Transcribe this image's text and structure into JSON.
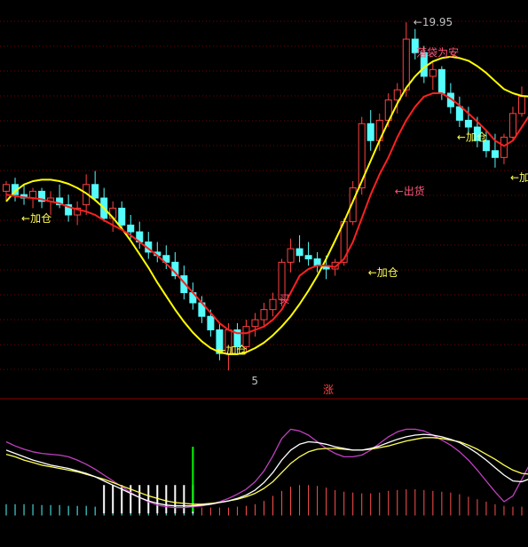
{
  "colors": {
    "up": "#ff4040",
    "down": "#54fcfc",
    "ma_fast": "#ff2020",
    "ma_slow": "#ffff00",
    "annotation": "#ffff54",
    "sell_annotation": "#ff5577",
    "price_label": "#c0c0c0",
    "separator": "#8b0000",
    "grid": "#7a0000",
    "k_line": "#ffffff",
    "d_line": "#ffff54",
    "j_line": "#c040c0",
    "hist_pos": "#ff5050",
    "hist_neg": "#54fcfc",
    "buy_bar": "#ffffff",
    "buy_marker": "#00ff00"
  },
  "chart_data": [
    {
      "type": "candlestick",
      "title": "",
      "grid": true,
      "ylim": [
        14.5,
        20.2
      ],
      "price_labels": {
        "high": "19.95",
        "low_fragment": "5"
      },
      "annotations": [
        {
          "index": 1,
          "text": "←加仓",
          "kind": "buy",
          "price": 17.05
        },
        {
          "index": 0,
          "text": "←加仓",
          "kind": "buy",
          "price": 15.1
        },
        {
          "index": 12,
          "text": "买",
          "kind": "buy",
          "price": 15.85
        },
        {
          "index": 21,
          "text": "←加仓",
          "kind": "buy",
          "price": 16.25
        },
        {
          "index": 17,
          "text": "←出货",
          "kind": "sell",
          "price": 17.45
        },
        {
          "index": 31,
          "text": "-落袋为安",
          "kind": "sell",
          "price": 19.5
        },
        {
          "index": 32,
          "text": "←加仓",
          "kind": "buy",
          "price": 18.25
        },
        {
          "index": 39,
          "text": "←加仓",
          "kind": "buy",
          "price": 17.65
        }
      ],
      "candles": [
        {
          "o": 17.45,
          "h": 17.6,
          "l": 17.3,
          "c": 17.55
        },
        {
          "o": 17.55,
          "h": 17.65,
          "l": 17.3,
          "c": 17.4
        },
        {
          "o": 17.4,
          "h": 17.55,
          "l": 17.25,
          "c": 17.35
        },
        {
          "o": 17.35,
          "h": 17.5,
          "l": 17.2,
          "c": 17.45
        },
        {
          "o": 17.45,
          "h": 17.5,
          "l": 17.2,
          "c": 17.3
        },
        {
          "o": 17.3,
          "h": 17.45,
          "l": 17.1,
          "c": 17.35
        },
        {
          "o": 17.35,
          "h": 17.55,
          "l": 17.2,
          "c": 17.25
        },
        {
          "o": 17.25,
          "h": 17.4,
          "l": 17.0,
          "c": 17.1
        },
        {
          "o": 17.1,
          "h": 17.3,
          "l": 16.95,
          "c": 17.2
        },
        {
          "o": 17.25,
          "h": 17.7,
          "l": 17.1,
          "c": 17.55
        },
        {
          "o": 17.55,
          "h": 17.75,
          "l": 17.3,
          "c": 17.35
        },
        {
          "o": 17.35,
          "h": 17.5,
          "l": 17.0,
          "c": 17.05
        },
        {
          "o": 17.05,
          "h": 17.3,
          "l": 16.85,
          "c": 17.2
        },
        {
          "o": 17.2,
          "h": 17.3,
          "l": 16.9,
          "c": 16.95
        },
        {
          "o": 16.95,
          "h": 17.1,
          "l": 16.75,
          "c": 16.85
        },
        {
          "o": 16.85,
          "h": 17.0,
          "l": 16.6,
          "c": 16.7
        },
        {
          "o": 16.7,
          "h": 16.85,
          "l": 16.45,
          "c": 16.55
        },
        {
          "o": 16.55,
          "h": 16.7,
          "l": 16.4,
          "c": 16.5
        },
        {
          "o": 16.5,
          "h": 16.65,
          "l": 16.3,
          "c": 16.4
        },
        {
          "o": 16.4,
          "h": 16.55,
          "l": 16.15,
          "c": 16.2
        },
        {
          "o": 16.2,
          "h": 16.35,
          "l": 15.85,
          "c": 15.95
        },
        {
          "o": 15.95,
          "h": 16.1,
          "l": 15.7,
          "c": 15.8
        },
        {
          "o": 15.8,
          "h": 15.9,
          "l": 15.5,
          "c": 15.6
        },
        {
          "o": 15.6,
          "h": 15.7,
          "l": 15.3,
          "c": 15.4
        },
        {
          "o": 15.4,
          "h": 15.5,
          "l": 14.95,
          "c": 15.05
        },
        {
          "o": 15.05,
          "h": 15.5,
          "l": 14.8,
          "c": 15.4
        },
        {
          "o": 15.4,
          "h": 15.5,
          "l": 15.05,
          "c": 15.15
        },
        {
          "o": 15.15,
          "h": 15.55,
          "l": 15.05,
          "c": 15.45
        },
        {
          "o": 15.45,
          "h": 15.65,
          "l": 15.3,
          "c": 15.55
        },
        {
          "o": 15.55,
          "h": 15.8,
          "l": 15.45,
          "c": 15.7
        },
        {
          "o": 15.7,
          "h": 15.95,
          "l": 15.6,
          "c": 15.85
        },
        {
          "o": 15.85,
          "h": 16.45,
          "l": 15.75,
          "c": 16.4
        },
        {
          "o": 16.4,
          "h": 16.75,
          "l": 16.25,
          "c": 16.6
        },
        {
          "o": 16.6,
          "h": 16.8,
          "l": 16.4,
          "c": 16.5
        },
        {
          "o": 16.5,
          "h": 16.7,
          "l": 16.35,
          "c": 16.45
        },
        {
          "o": 16.45,
          "h": 16.55,
          "l": 16.25,
          "c": 16.35
        },
        {
          "o": 16.35,
          "h": 16.5,
          "l": 16.15,
          "c": 16.3
        },
        {
          "o": 16.3,
          "h": 16.45,
          "l": 16.2,
          "c": 16.4
        },
        {
          "o": 16.4,
          "h": 17.05,
          "l": 16.35,
          "c": 17.0
        },
        {
          "o": 17.0,
          "h": 17.6,
          "l": 16.95,
          "c": 17.5
        },
        {
          "o": 17.5,
          "h": 18.55,
          "l": 17.4,
          "c": 18.45
        },
        {
          "o": 18.45,
          "h": 18.65,
          "l": 18.05,
          "c": 18.2
        },
        {
          "o": 18.2,
          "h": 18.6,
          "l": 18.05,
          "c": 18.5
        },
        {
          "o": 18.5,
          "h": 18.9,
          "l": 18.4,
          "c": 18.8
        },
        {
          "o": 18.8,
          "h": 19.05,
          "l": 18.6,
          "c": 18.95
        },
        {
          "o": 18.95,
          "h": 19.95,
          "l": 18.85,
          "c": 19.7
        },
        {
          "o": 19.7,
          "h": 19.85,
          "l": 19.4,
          "c": 19.5
        },
        {
          "o": 19.5,
          "h": 19.6,
          "l": 19.05,
          "c": 19.15
        },
        {
          "o": 19.15,
          "h": 19.35,
          "l": 18.95,
          "c": 19.25
        },
        {
          "o": 19.25,
          "h": 19.3,
          "l": 18.8,
          "c": 18.9
        },
        {
          "o": 18.9,
          "h": 19.05,
          "l": 18.6,
          "c": 18.7
        },
        {
          "o": 18.7,
          "h": 18.85,
          "l": 18.4,
          "c": 18.5
        },
        {
          "o": 18.5,
          "h": 18.7,
          "l": 18.3,
          "c": 18.4
        },
        {
          "o": 18.4,
          "h": 18.55,
          "l": 18.1,
          "c": 18.2
        },
        {
          "o": 18.2,
          "h": 18.35,
          "l": 17.95,
          "c": 18.05
        },
        {
          "o": 18.05,
          "h": 18.3,
          "l": 17.8,
          "c": 17.95
        },
        {
          "o": 17.95,
          "h": 18.3,
          "l": 17.85,
          "c": 18.25
        },
        {
          "o": 18.25,
          "h": 18.7,
          "l": 18.2,
          "c": 18.6
        },
        {
          "o": 18.6,
          "h": 19.0,
          "l": 18.55,
          "c": 18.85
        }
      ],
      "ma_fast": [
        17.4,
        17.38,
        17.36,
        17.35,
        17.33,
        17.3,
        17.27,
        17.22,
        17.18,
        17.15,
        17.1,
        17.02,
        16.95,
        16.88,
        16.8,
        16.7,
        16.6,
        16.5,
        16.38,
        16.25,
        16.1,
        15.95,
        15.8,
        15.65,
        15.5,
        15.4,
        15.35,
        15.35,
        15.4,
        15.45,
        15.55,
        15.7,
        15.95,
        16.2,
        16.3,
        16.35,
        16.35,
        16.33,
        16.45,
        16.7,
        17.05,
        17.4,
        17.7,
        17.95,
        18.25,
        18.5,
        18.7,
        18.85,
        18.9,
        18.9,
        18.82,
        18.72,
        18.6,
        18.48,
        18.35,
        18.2,
        18.12,
        18.2,
        18.4,
        18.6
      ],
      "ma_slow": [
        17.3,
        17.45,
        17.55,
        17.6,
        17.62,
        17.62,
        17.6,
        17.56,
        17.5,
        17.42,
        17.32,
        17.2,
        17.06,
        16.9,
        16.72,
        16.52,
        16.32,
        16.1,
        15.9,
        15.7,
        15.52,
        15.36,
        15.23,
        15.13,
        15.07,
        15.04,
        15.04,
        15.07,
        15.13,
        15.21,
        15.32,
        15.45,
        15.6,
        15.78,
        15.98,
        16.2,
        16.45,
        16.72,
        17.0,
        17.3,
        17.6,
        17.9,
        18.2,
        18.48,
        18.75,
        18.98,
        19.15,
        19.28,
        19.37,
        19.42,
        19.44,
        19.42,
        19.38,
        19.3,
        19.2,
        19.08,
        18.96,
        18.9,
        18.86,
        18.85
      ]
    },
    {
      "type": "line",
      "title": "涨",
      "legend": false,
      "grid": false,
      "ylim": [
        -40,
        120
      ],
      "series": [
        {
          "values": [
            80,
            75,
            71,
            68,
            66,
            65,
            64,
            62,
            58,
            53,
            47,
            40,
            33,
            26,
            19,
            13,
            8,
            4,
            2,
            1,
            1,
            2,
            3,
            5,
            8,
            12,
            17,
            23,
            32,
            45,
            63,
            84,
            95,
            93,
            88,
            80,
            72,
            66,
            62,
            62,
            64,
            70,
            78,
            86,
            92,
            95,
            95,
            93,
            88,
            82,
            76,
            68,
            58,
            46,
            33,
            20,
            8,
            15,
            35,
            55
          ]
        },
        {
          "values": [
            70,
            66,
            62,
            58,
            55,
            52,
            50,
            48,
            45,
            42,
            38,
            33,
            28,
            23,
            18,
            13,
            9,
            6,
            4,
            3,
            3,
            3,
            4,
            5,
            7,
            9,
            12,
            16,
            22,
            31,
            43,
            58,
            70,
            77,
            80,
            79,
            77,
            74,
            72,
            70,
            70,
            72,
            75,
            79,
            83,
            86,
            88,
            89,
            88,
            86,
            83,
            79,
            73,
            66,
            58,
            49,
            40,
            33,
            32,
            36
          ]
        },
        {
          "values": [
            65,
            62,
            58,
            55,
            52,
            50,
            48,
            46,
            44,
            41,
            38,
            35,
            31,
            27,
            23,
            19,
            15,
            12,
            9,
            7,
            6,
            5,
            5,
            6,
            7,
            9,
            11,
            14,
            18,
            24,
            32,
            43,
            54,
            62,
            68,
            71,
            72,
            72,
            71,
            70,
            70,
            71,
            73,
            75,
            78,
            81,
            83,
            85,
            85,
            84,
            82,
            80,
            76,
            71,
            65,
            59,
            52,
            46,
            42,
            41
          ]
        },
        {
          "values": [
            5,
            5,
            5,
            5,
            4,
            4,
            4,
            3,
            3,
            3,
            2,
            2,
            2,
            2,
            1,
            1,
            1,
            1,
            1,
            1,
            1,
            1,
            1,
            1,
            1,
            1,
            2,
            3,
            5,
            9,
            15,
            21,
            26,
            28,
            28,
            27,
            25,
            22,
            20,
            19,
            18,
            18,
            19,
            21,
            22,
            23,
            23,
            22,
            21,
            20,
            19,
            17,
            14,
            11,
            8,
            5,
            3,
            2,
            2,
            3
          ]
        }
      ],
      "buy_range": [
        11,
        21
      ],
      "buy_marker_index": 21
    }
  ]
}
